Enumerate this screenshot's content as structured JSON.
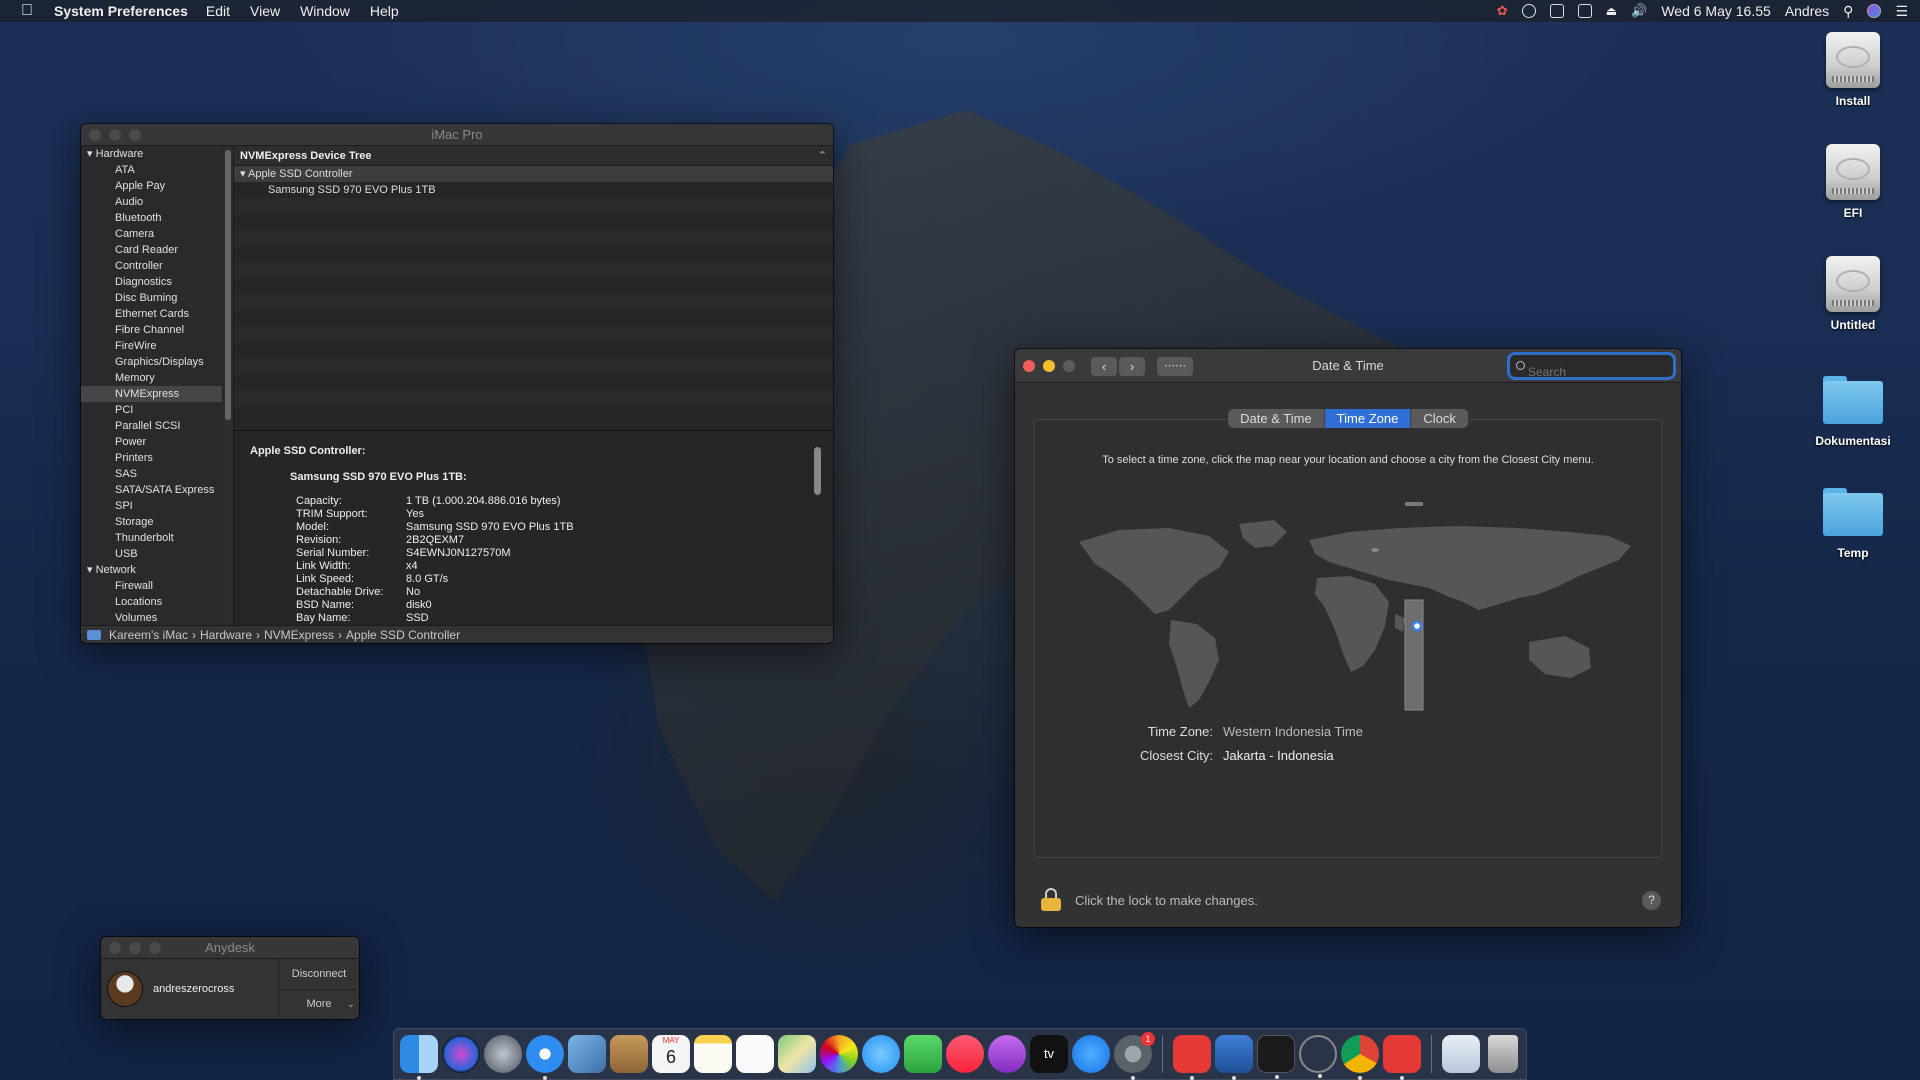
{
  "menubar": {
    "app_name": "System Preferences",
    "menus": [
      "Edit",
      "View",
      "Window",
      "Help"
    ],
    "clock": "Wed 6 May  16.55",
    "user": "Andres"
  },
  "sysinfo": {
    "title": "iMac Pro",
    "sidebar": {
      "hardware_label": "Hardware",
      "hardware_items": [
        "ATA",
        "Apple Pay",
        "Audio",
        "Bluetooth",
        "Camera",
        "Card Reader",
        "Controller",
        "Diagnostics",
        "Disc Burning",
        "Ethernet Cards",
        "Fibre Channel",
        "FireWire",
        "Graphics/Displays",
        "Memory",
        "NVMExpress",
        "PCI",
        "Parallel SCSI",
        "Power",
        "Printers",
        "SAS",
        "SATA/SATA Express",
        "SPI",
        "Storage",
        "Thunderbolt",
        "USB"
      ],
      "selected": "NVMExpress",
      "network_label": "Network",
      "network_items": [
        "Firewall",
        "Locations",
        "Volumes"
      ]
    },
    "tree": {
      "header": "NVMExpress Device Tree",
      "controller": "Apple SSD Controller",
      "device": "Samsung SSD 970 EVO Plus 1TB"
    },
    "detail": {
      "controller_title": "Apple SSD Controller:",
      "device_title": "Samsung SSD 970 EVO Plus 1TB:",
      "fields": [
        {
          "k": "Capacity:",
          "v": "1 TB (1.000.204.886.016 bytes)"
        },
        {
          "k": "TRIM Support:",
          "v": "Yes"
        },
        {
          "k": "Model:",
          "v": "Samsung SSD 970 EVO Plus 1TB"
        },
        {
          "k": "Revision:",
          "v": "2B2QEXM7"
        },
        {
          "k": "Serial Number:",
          "v": "S4EWNJ0N127570M"
        },
        {
          "k": "Link Width:",
          "v": "x4"
        },
        {
          "k": "Link Speed:",
          "v": "8.0 GT/s"
        },
        {
          "k": "Detachable Drive:",
          "v": "No"
        },
        {
          "k": "BSD Name:",
          "v": "disk0"
        },
        {
          "k": "Bay Name:",
          "v": "SSD"
        }
      ]
    },
    "breadcrumb": [
      "Kareem's iMac",
      "Hardware",
      "NVMExpress",
      "Apple SSD Controller"
    ]
  },
  "datetime": {
    "title": "Date & Time",
    "search_placeholder": "Search",
    "tabs": [
      "Date & Time",
      "Time Zone",
      "Clock"
    ],
    "active_tab": "Time Zone",
    "instruction": "To select a time zone, click the map near your location and choose a city from the Closest City menu.",
    "time_zone_label": "Time Zone:",
    "time_zone_value": "Western Indonesia Time",
    "closest_city_label": "Closest City:",
    "closest_city_value": "Jakarta - Indonesia",
    "lock_text": "Click the lock to make changes.",
    "help": "?"
  },
  "anydesk": {
    "title": "Anydesk",
    "user": "andreszerocross",
    "disconnect": "Disconnect",
    "more": "More"
  },
  "desktop_icons": [
    "Install",
    "EFI",
    "Untitled",
    "Dokumentasi",
    "Temp"
  ],
  "dock": {
    "calendar_month": "MAY",
    "calendar_day": "6",
    "appletv_label": "tv",
    "sysprefs_badge": "1"
  }
}
